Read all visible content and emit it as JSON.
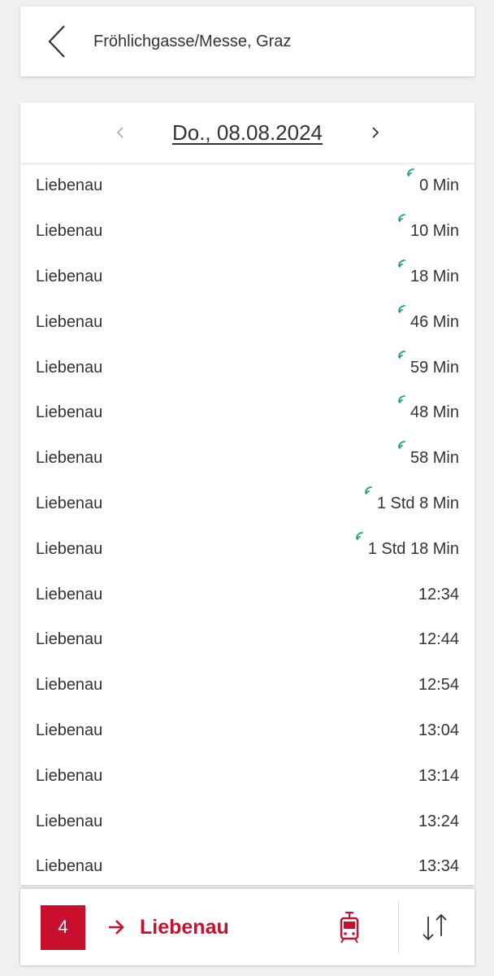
{
  "header": {
    "stop_name": "Fröhlichgasse/Messe, Graz"
  },
  "date_nav": {
    "date": "Do., 08.08.2024"
  },
  "departures": [
    {
      "destination": "Liebenau",
      "time": "0 Min",
      "realtime": true
    },
    {
      "destination": "Liebenau",
      "time": "10 Min",
      "realtime": true
    },
    {
      "destination": "Liebenau",
      "time": "18 Min",
      "realtime": true
    },
    {
      "destination": "Liebenau",
      "time": "46 Min",
      "realtime": true
    },
    {
      "destination": "Liebenau",
      "time": "59 Min",
      "realtime": true
    },
    {
      "destination": "Liebenau",
      "time": "48 Min",
      "realtime": true
    },
    {
      "destination": "Liebenau",
      "time": "58 Min",
      "realtime": true
    },
    {
      "destination": "Liebenau",
      "time": "1 Std 8 Min",
      "realtime": true
    },
    {
      "destination": "Liebenau",
      "time": "1 Std 18 Min",
      "realtime": true
    },
    {
      "destination": "Liebenau",
      "time": "12:34",
      "realtime": false
    },
    {
      "destination": "Liebenau",
      "time": "12:44",
      "realtime": false
    },
    {
      "destination": "Liebenau",
      "time": "12:54",
      "realtime": false
    },
    {
      "destination": "Liebenau",
      "time": "13:04",
      "realtime": false
    },
    {
      "destination": "Liebenau",
      "time": "13:14",
      "realtime": false
    },
    {
      "destination": "Liebenau",
      "time": "13:24",
      "realtime": false
    },
    {
      "destination": "Liebenau",
      "time": "13:34",
      "realtime": false
    }
  ],
  "footer": {
    "line_number": "4",
    "direction": "Liebenau"
  },
  "colors": {
    "brand_red": "#c8102e",
    "realtime_green": "#1aa36e",
    "text": "#333333"
  },
  "icons": {
    "back": "chevron-left-icon",
    "prev_date": "chevron-left-icon",
    "next_date": "chevron-right-icon",
    "realtime": "realtime-signal-icon",
    "direction_arrow": "arrow-right-icon",
    "vehicle": "tram-icon",
    "swap": "swap-direction-icon"
  }
}
